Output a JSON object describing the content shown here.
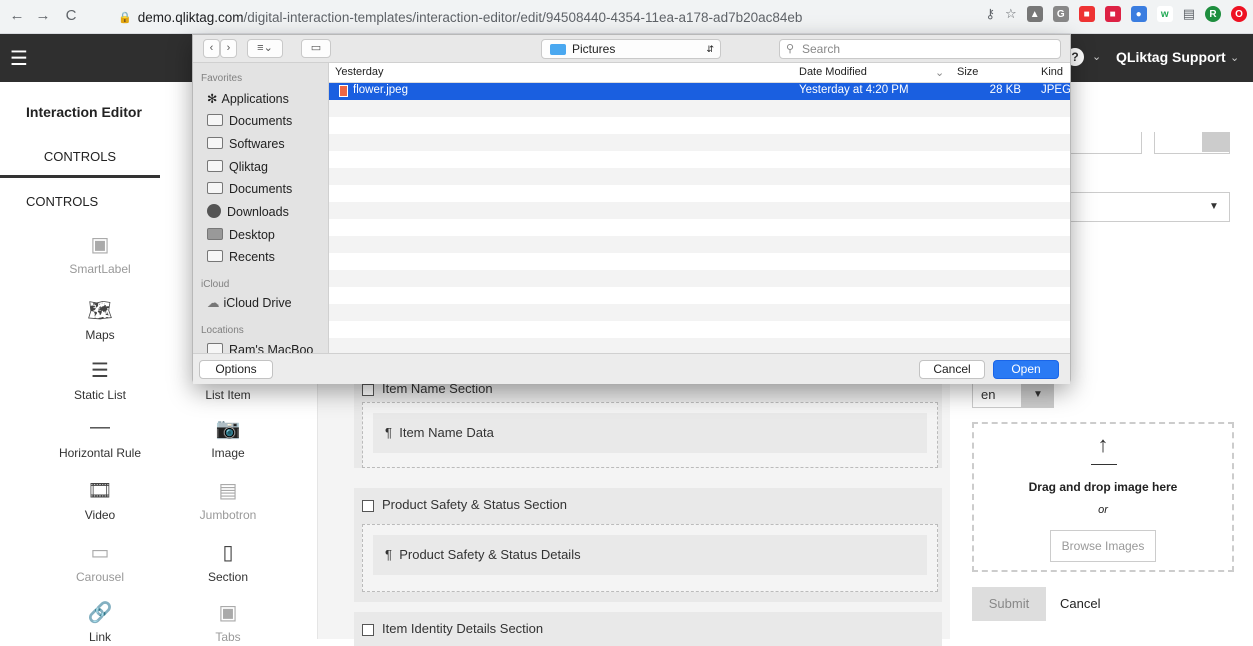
{
  "browser": {
    "back": "←",
    "forward": "→",
    "reload": "C",
    "url_host": "demo.qliktag.com",
    "url_path": "/digital-interaction-templates/interaction-editor/edit/94508440-4354-11ea-a178-ad7b20ac84eb",
    "profile_initial": "R"
  },
  "header": {
    "user_name": "QLiktag Support"
  },
  "left_panel": {
    "title": "Interaction Editor",
    "tab": "CONTROLS",
    "section": "CONTROLS",
    "controls": [
      {
        "label": "SmartLabel",
        "disabled": true
      },
      {
        "label": "Maps",
        "disabled": false
      },
      {
        "label": "Static List",
        "disabled": false
      },
      {
        "label": "List Item",
        "disabled": false
      },
      {
        "label": "Horizontal Rule",
        "disabled": false
      },
      {
        "label": "Image",
        "disabled": false
      },
      {
        "label": "Video",
        "disabled": false
      },
      {
        "label": "Jumbotron",
        "disabled": true
      },
      {
        "label": "Carousel",
        "disabled": true
      },
      {
        "label": "Section",
        "disabled": false
      },
      {
        "label": "Link",
        "disabled": false
      },
      {
        "label": "Tabs",
        "disabled": true
      }
    ]
  },
  "canvas": {
    "sections": [
      {
        "title": "Item Name Section",
        "data": "Item Name Data"
      },
      {
        "title": "Product Safety & Status Section",
        "data": "Product Safety & Status Details"
      },
      {
        "title": "Item Identity Details Section"
      }
    ]
  },
  "right_panel": {
    "partial_label": "s",
    "language": "en",
    "dropzone_title": "Drag and drop image here",
    "dropzone_or": "or",
    "browse_label": "Browse Images",
    "submit_label": "Submit",
    "cancel_label": "Cancel"
  },
  "file_dialog": {
    "location": "Pictures",
    "search_placeholder": "Search",
    "sidebar": {
      "favorites_heading": "Favorites",
      "favorites": [
        "Applications",
        "Documents",
        "Softwares",
        "Qliktag",
        "Documents",
        "Downloads",
        "Desktop",
        "Recents"
      ],
      "icloud_heading": "iCloud",
      "icloud": [
        "iCloud Drive"
      ],
      "locations_heading": "Locations",
      "locations": [
        "Ram's MacBoo"
      ]
    },
    "columns": {
      "name": "Yesterday",
      "date": "Date Modified",
      "size": "Size",
      "kind": "Kind"
    },
    "files": [
      {
        "name": "flower.jpeg",
        "date": "Yesterday at 4:20 PM",
        "size": "28 KB",
        "kind": "JPEG"
      }
    ],
    "options_label": "Options",
    "cancel_label": "Cancel",
    "open_label": "Open"
  }
}
